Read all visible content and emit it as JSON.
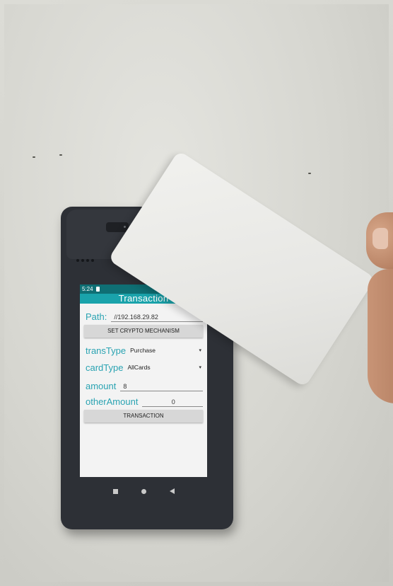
{
  "device": {
    "status_time": "5:24",
    "app_title": "Transaction",
    "path": {
      "label": "Path:",
      "value": "//192.168.29.82"
    },
    "crypto_button": "SET CRYPTO MECHANISM",
    "trans_type": {
      "label": "transType",
      "value": "Purchase"
    },
    "card_type": {
      "label": "cardType",
      "value": "AllCards"
    },
    "amount": {
      "label": "amount",
      "value": "8"
    },
    "other_amount": {
      "label": "otherAmount",
      "value": "0"
    },
    "transaction_button": "TRANSACTION"
  },
  "colors": {
    "accent": "#1aa3ab",
    "label_text": "#2aa3b2",
    "status_bar": "#0f6f74"
  },
  "icons": [
    "sim-card-icon",
    "dropdown-caret-icon",
    "nav-recents-icon",
    "nav-home-icon",
    "nav-back-icon"
  ]
}
